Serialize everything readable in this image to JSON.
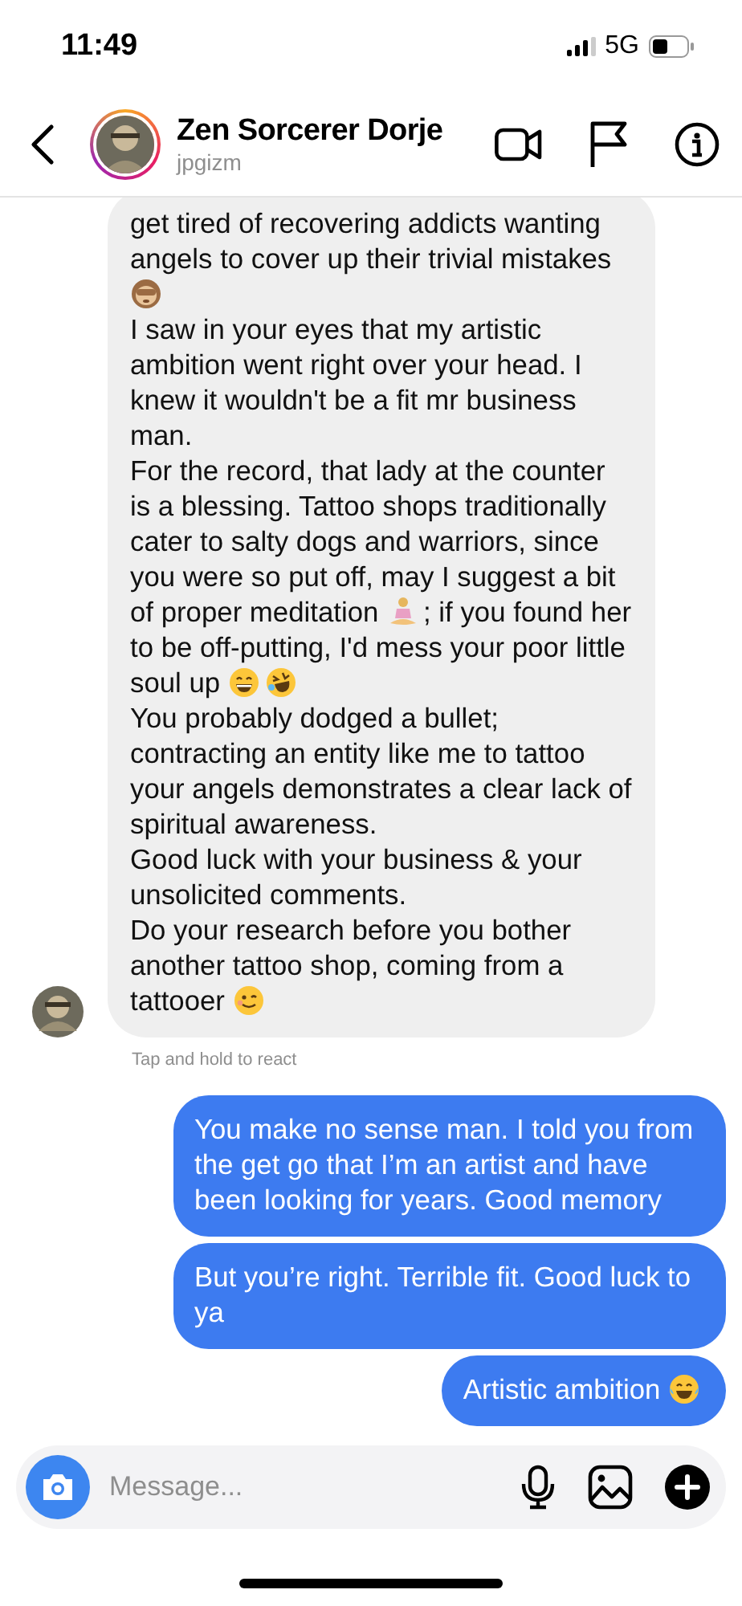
{
  "status_bar": {
    "time": "11:49",
    "network": "5G"
  },
  "header": {
    "name": "Zen Sorcerer Dorje",
    "username": "jpgizm"
  },
  "messages": [
    {
      "kind": "received",
      "paragraphs": [
        [
          {
            "kind": "text",
            "text": "get tired of recovering addicts wanting angels to cover up their trivial mistakes"
          },
          {
            "kind": "break"
          },
          {
            "kind": "monkey"
          }
        ],
        [
          {
            "kind": "text",
            "text": "I saw in your eyes that my artistic ambition went right over your head. I knew it wouldn't be a fit mr business man."
          }
        ],
        [
          {
            "kind": "text",
            "text": "For the record, that lady at the counter is a blessing. Tattoo shops traditionally cater to salty dogs and warriors, since you were so put off, may I suggest a bit of proper meditation "
          },
          {
            "kind": "meditation"
          },
          {
            "kind": "text",
            "text": "; if you found her to be off-putting, I'd mess your poor little soul up "
          },
          {
            "kind": "grin"
          },
          {
            "kind": "rofl"
          }
        ],
        [
          {
            "kind": "text",
            "text": "You probably dodged a bullet; contracting an entity like me to tattoo your angels demonstrates a clear lack of spiritual awareness."
          }
        ],
        [
          {
            "kind": "text",
            "text": "Good luck with your business & your unsolicited comments."
          }
        ],
        [
          {
            "kind": "text",
            "text": "Do your research before you bother another tattoo shop, coming from a tattooer "
          },
          {
            "kind": "wink"
          }
        ]
      ]
    },
    {
      "kind": "sent",
      "paragraphs": [
        [
          {
            "kind": "text",
            "text": "You make no sense man. I told you from the get go that I’m an artist and have been looking for years. Good memory"
          }
        ]
      ]
    },
    {
      "kind": "sent",
      "paragraphs": [
        [
          {
            "kind": "text",
            "text": "But you’re right. Terrible fit. Good luck to ya"
          }
        ]
      ]
    },
    {
      "kind": "sent",
      "paragraphs": [
        [
          {
            "kind": "text",
            "text": "Artistic ambition "
          },
          {
            "kind": "tears"
          }
        ]
      ]
    }
  ],
  "react_hint": "Tap and hold to react",
  "composer": {
    "placeholder": "Message..."
  }
}
